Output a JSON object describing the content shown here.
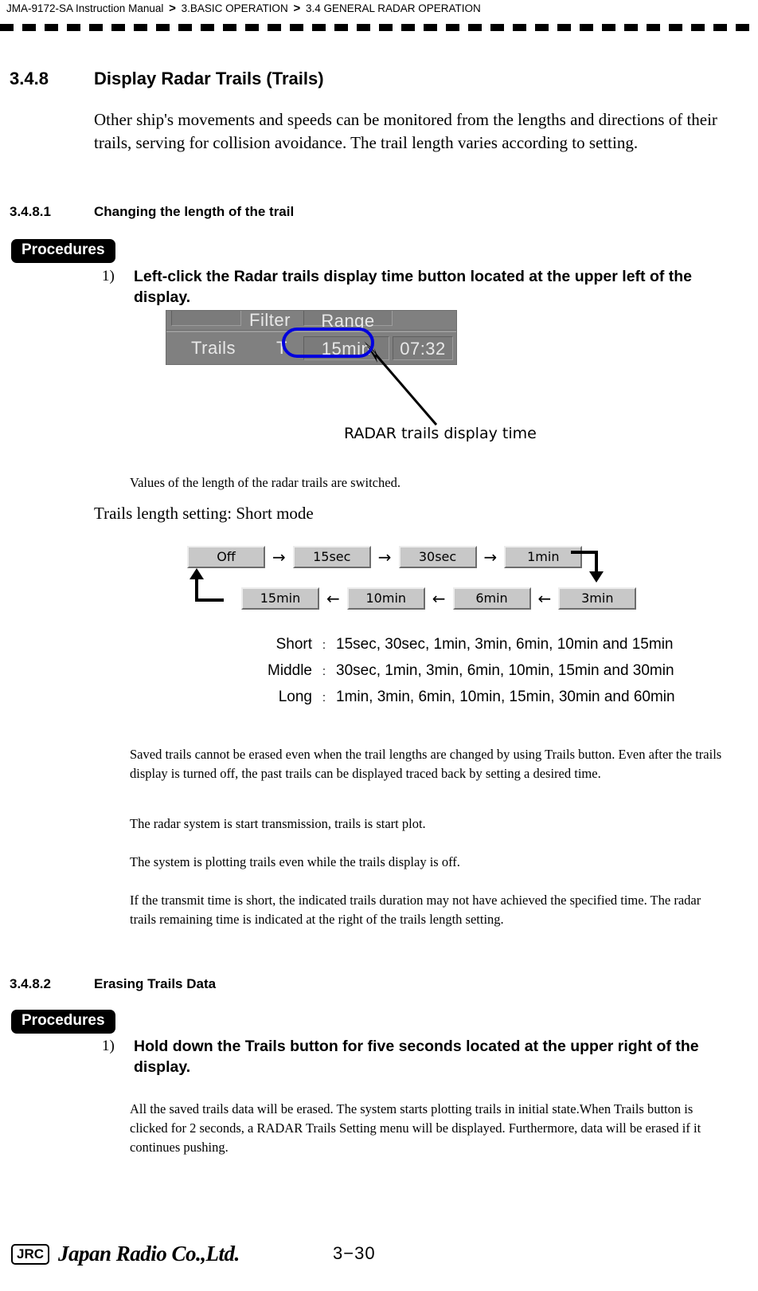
{
  "header": {
    "manual": "JMA-9172-SA Instruction Manual",
    "sep1": ">",
    "chapter": "3.BASIC OPERATION",
    "sep2": ">",
    "section": "3.4  GENERAL RADAR OPERATION"
  },
  "sections": {
    "s1": {
      "number": "3.4.8",
      "title": "Display Radar Trails (Trails)",
      "intro": "Other ship's movements and speeds can be monitored from the lengths and directions of their trails, serving for collision avoidance. The trail length varies according to setting."
    },
    "s1_1": {
      "number": "3.4.8.1",
      "title": "Changing the length of the trail",
      "procedures_label": "Procedures",
      "step1_num": "1)",
      "step1_text": "Left-click the  Radar trails display time button located at the upper left of the display.",
      "after_figure_note": "Values of the length of the radar trails are switched.",
      "mode_heading": "Trails length setting: Short mode"
    },
    "s1_2": {
      "number": "3.4.8.2",
      "title": "Erasing Trails Data",
      "procedures_label": "Procedures",
      "step1_num": "1)",
      "step1_text": "Hold down the  Trails  button for five seconds located at the upper right of the display.",
      "note": "All the saved trails data will be erased. The system starts plotting trails in initial state.When Trails  button is clicked for 2 seconds, a RADAR Trails Setting menu will be displayed. Furthermore, data will be erased if it continues pushing."
    }
  },
  "figure": {
    "callout_label": "RADAR trails display time",
    "panel": {
      "top_row": {
        "blank": "",
        "filter": "Filter",
        "range": "Range"
      },
      "bottom_row": {
        "trails": "Trails",
        "t": "T",
        "value": "15min",
        "time": "07:32"
      }
    },
    "highlight_color": "#0000dd"
  },
  "flow": {
    "row1": [
      "Off",
      "15sec",
      "30sec",
      "1min"
    ],
    "row1_arrows": [
      "→",
      "→",
      "→"
    ],
    "row2": [
      "15min",
      "10min",
      "6min",
      "3min"
    ],
    "row2_arrows": [
      "←",
      "←",
      "←"
    ]
  },
  "mode_table": {
    "colon": ":",
    "rows": [
      {
        "name": "Short",
        "values": "15sec, 30sec, 1min, 3min, 6min, 10min and 15min"
      },
      {
        "name": "Middle",
        "values": "30sec, 1min, 3min, 6min, 10min, 15min and 30min"
      },
      {
        "name": "Long",
        "values": "1min, 3min, 6min, 10min, 15min, 30min and 60min"
      }
    ]
  },
  "notes": {
    "n1": "Saved trails cannot be erased even when the trail lengths are changed by using  Trails button. Even after the trails display is turned off, the past trails can be displayed traced back by setting a desired time.",
    "n2": "The radar system is start transmission, trails is start plot.",
    "n3": "The system is plotting trails even while the trails display is off.",
    "n4": "If the transmit time is short, the indicated trails duration may not have achieved the specified time. The radar trails remaining time is indicated at the right of the trails length setting."
  },
  "footer": {
    "logo_box": "JRC",
    "company": "Japan Radio Co.,Ltd.",
    "page": "3−30"
  }
}
